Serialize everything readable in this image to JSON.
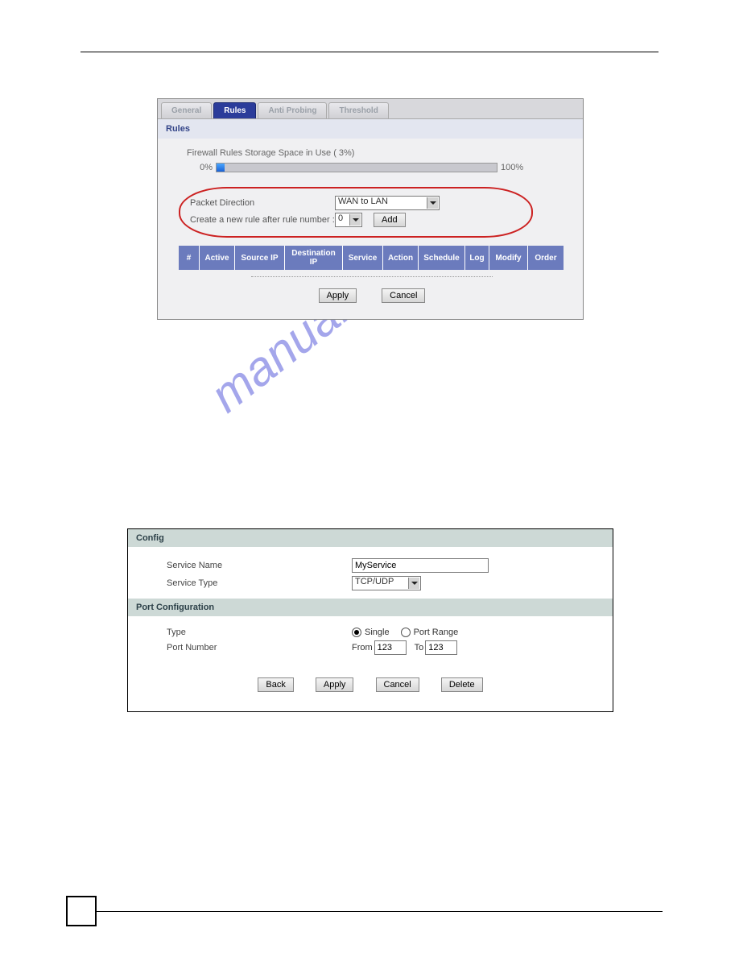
{
  "watermark_text": "manualshive.com",
  "panel1": {
    "tabs": [
      "General",
      "Rules",
      "Anti Probing",
      "Threshold"
    ],
    "active_tab_index": 1,
    "section_title": "Rules",
    "storage_label": "Firewall Rules Storage Space in Use  ( 3%)",
    "progress_left": "0%",
    "progress_right": "100%",
    "progress_percent": 3,
    "packet_direction_label": "Packet Direction",
    "packet_direction_value": "WAN to LAN",
    "create_rule_label": "Create a new rule after rule number :",
    "create_rule_value": "0",
    "add_button": "Add",
    "columns": [
      "#",
      "Active",
      "Source IP",
      "Destination IP",
      "Service",
      "Action",
      "Schedule",
      "Log",
      "Modify",
      "Order"
    ],
    "apply_button": "Apply",
    "cancel_button": "Cancel"
  },
  "panel2": {
    "config_title": "Config",
    "service_name_label": "Service Name",
    "service_name_value": "MyService",
    "service_type_label": "Service Type",
    "service_type_value": "TCP/UDP",
    "port_config_title": "Port Configuration",
    "type_label": "Type",
    "radio_single": "Single",
    "radio_port_range": "Port Range",
    "radio_selected": "single",
    "port_number_label": "Port Number",
    "from_label": "From",
    "from_value": "123",
    "to_label": "To",
    "to_value": "123",
    "back_button": "Back",
    "apply_button": "Apply",
    "cancel_button": "Cancel",
    "delete_button": "Delete"
  }
}
